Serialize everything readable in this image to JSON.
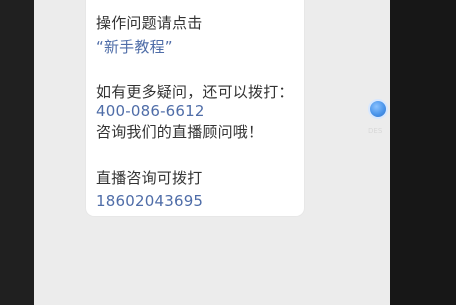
{
  "message": {
    "line1": "操作问题请点击",
    "line2": "“新手教程”",
    "line3": "如有更多疑问，还可以拨打：",
    "line4": "400-086-6612",
    "line5": "咨询我们的直播顾问哦！",
    "line6": "直播咨询可拨打",
    "line7": "18602043695"
  },
  "floating_indicator": {
    "label": "DES"
  },
  "colors": {
    "text": "#333333",
    "link": "#4f6da8",
    "background": "#ececec",
    "card": "#ffffff",
    "indicator": "#4b95ea"
  }
}
